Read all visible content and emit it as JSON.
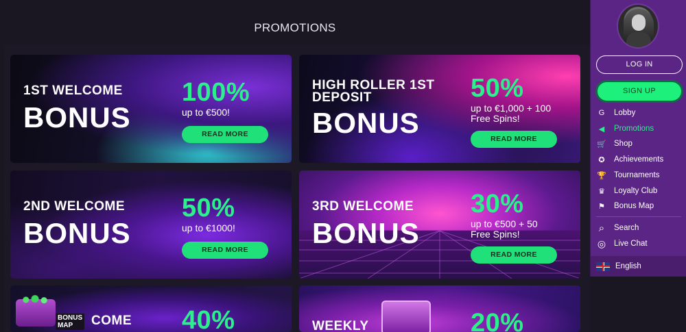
{
  "page": {
    "title": "PROMOTIONS"
  },
  "cards": [
    {
      "line1": "1ST WELCOME",
      "line2": "BONUS",
      "percent": "100%",
      "sub": "up to €500!",
      "button": "READ MORE"
    },
    {
      "line1": "HIGH ROLLER 1ST",
      "line1b": "DEPOSIT",
      "line2": "BONUS",
      "percent": "50%",
      "sub": "up to €1,000 + 100",
      "sub2": "Free Spins!",
      "button": "READ MORE"
    },
    {
      "line1": "2ND WELCOME",
      "line2": "BONUS",
      "percent": "50%",
      "sub": "up to €1000!",
      "button": "READ MORE"
    },
    {
      "line1": "3RD WELCOME",
      "line2": "BONUS",
      "percent": "30%",
      "sub": "up to €500 + 50",
      "sub2": "Free Spins!",
      "button": "READ MORE"
    },
    {
      "line1": "COME",
      "badge_line1": "BONUS",
      "badge_line2": "MAP",
      "percent": "40%"
    },
    {
      "line1": "WEEKLY",
      "percent": "20%"
    }
  ],
  "sidebar": {
    "login": "LOG IN",
    "signup": "SIGN UP",
    "items": [
      {
        "label": "Lobby",
        "icon": "lobby-icon",
        "glyph": "G"
      },
      {
        "label": "Promotions",
        "icon": "megaphone-icon",
        "glyph": "◀"
      },
      {
        "label": "Shop",
        "icon": "cart-icon",
        "glyph": "🛒"
      },
      {
        "label": "Achievements",
        "icon": "medal-icon",
        "glyph": "✪"
      },
      {
        "label": "Tournaments",
        "icon": "trophy-icon",
        "glyph": "🏆"
      },
      {
        "label": "Loyalty Club",
        "icon": "crown-icon",
        "glyph": "♛"
      },
      {
        "label": "Bonus Map",
        "icon": "map-pin-icon",
        "glyph": "⚑"
      },
      {
        "label": "Search",
        "icon": "search-icon",
        "glyph": "⌕"
      },
      {
        "label": "Live Chat",
        "icon": "chat-icon",
        "glyph": "◎"
      }
    ],
    "language": "English"
  },
  "colors": {
    "accent": "#2cf08c",
    "sidebar": "#5b2586",
    "background": "#1a1622"
  }
}
